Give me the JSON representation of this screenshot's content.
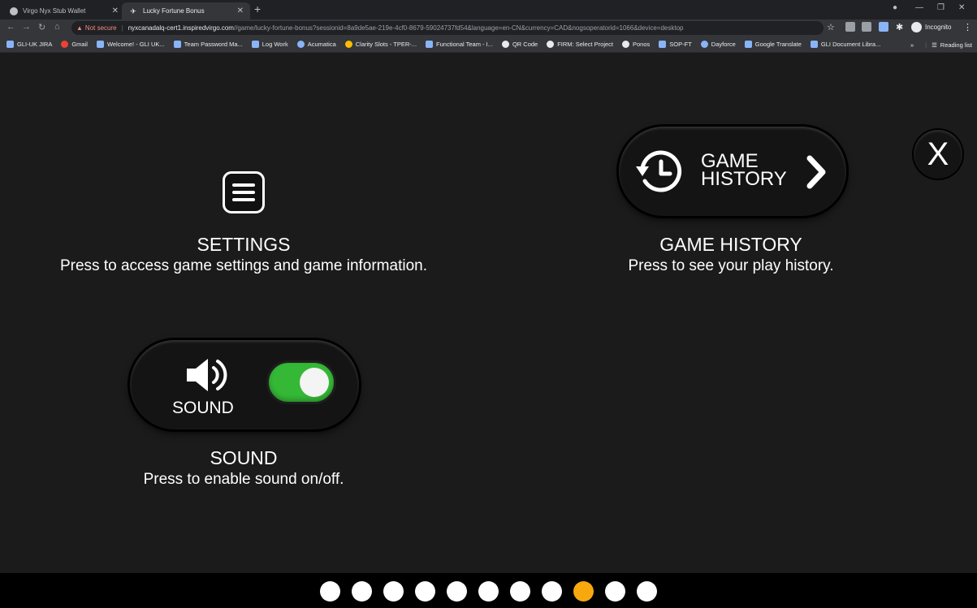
{
  "browser": {
    "tabs": [
      {
        "title": "Virgo Nyx Stub Wallet",
        "active": false
      },
      {
        "title": "Lucky Fortune Bonus",
        "active": true
      }
    ],
    "security_label": "Not secure",
    "url_host": "nyxcanadalq-cert1.inspiredvirgo.com",
    "url_path": "//game/lucky-fortune-bonus?sessionid=8a9de5ae-219e-4cf0-8679-59024737fd54&language=en-CN&currency=CAD&nogsoperatorid=1066&device=desktop",
    "profile_label": "Incognito",
    "bookmarks": [
      "GLI-UK JIRA",
      "Gmail",
      "Welcome! - GLI UK...",
      "Team Password Ma...",
      "Log Work",
      "Acumatica",
      "Clarity Slots - TPER-...",
      "Functional Team - I...",
      "QR Code",
      "FIRM: Select Project",
      "Ponos",
      "SOP-FT",
      "Dayforce",
      "Google Translate",
      "GLI Document Libra..."
    ],
    "overflow_label": "»",
    "reading_list_label": "Reading list"
  },
  "game": {
    "settings": {
      "title": "SETTINGS",
      "description": "Press to access game settings and game information."
    },
    "game_history": {
      "button_line1": "GAME",
      "button_line2": "HISTORY",
      "title": "GAME HISTORY",
      "description": "Press to see your play history."
    },
    "close_label": "X",
    "sound": {
      "button_label": "SOUND",
      "enabled": true,
      "title": "SOUND",
      "description": "Press to enable sound on/off."
    },
    "pagination": {
      "total": 11,
      "active_index": 8,
      "active_color": "#f7a80f"
    }
  }
}
